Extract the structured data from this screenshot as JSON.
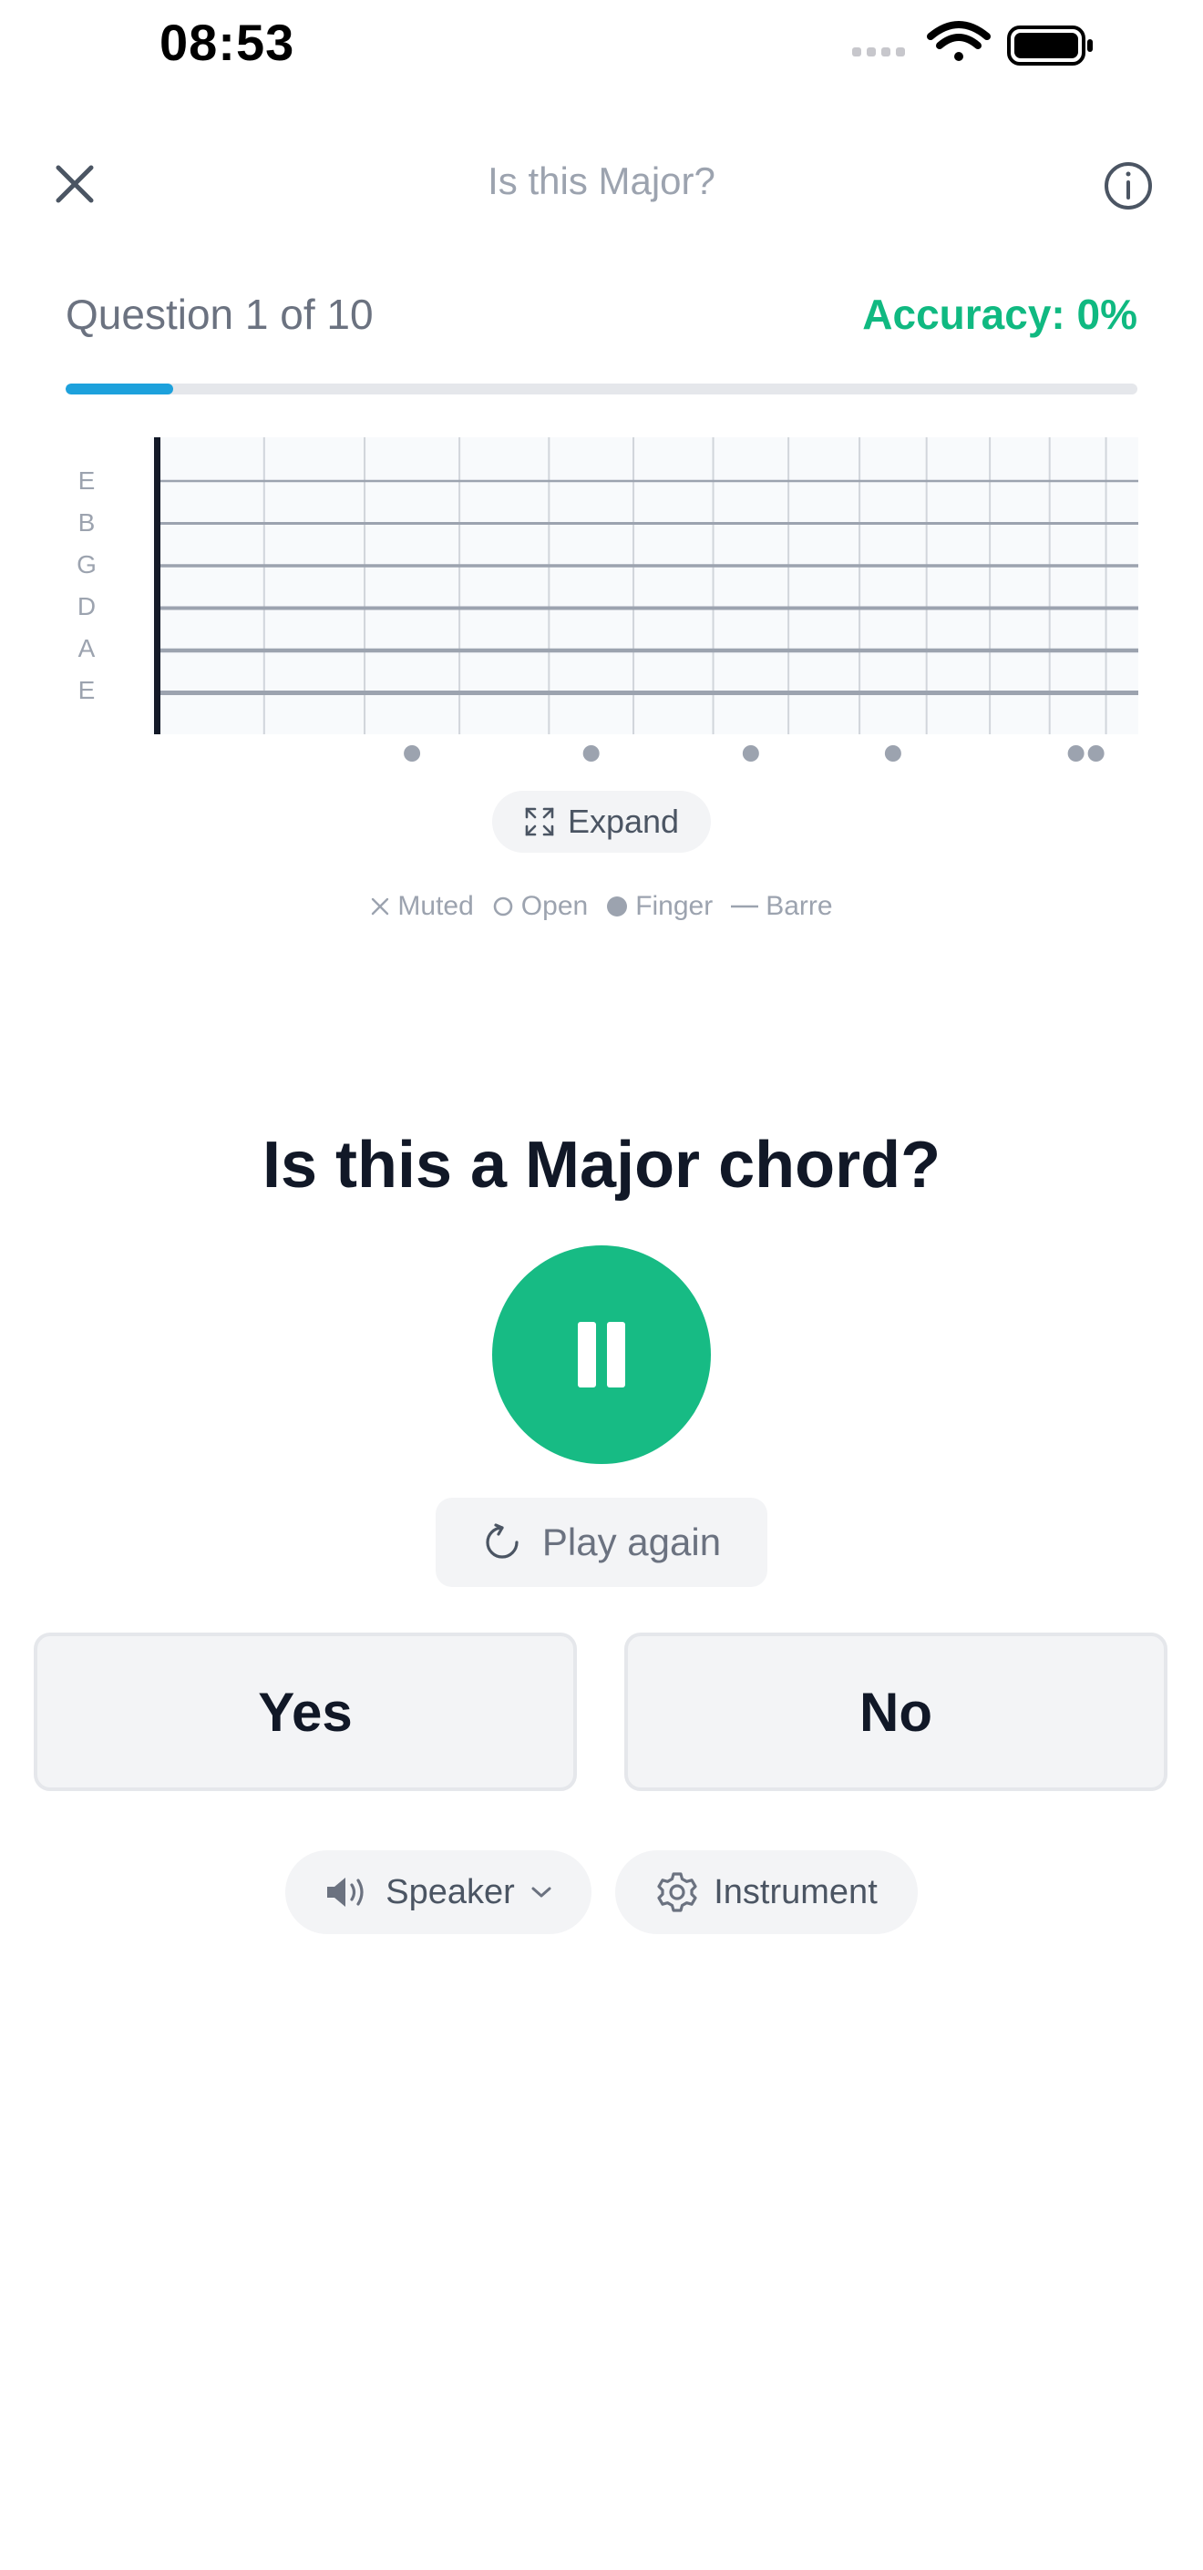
{
  "status_bar": {
    "time": "08:53"
  },
  "header": {
    "title": "Is this Major?"
  },
  "progress": {
    "question_label": "Question 1 of 10",
    "accuracy_label": "Accuracy: 0%",
    "fraction": 0.1,
    "color": "#1da1dc"
  },
  "fretboard": {
    "strings": [
      "E",
      "B",
      "G",
      "D",
      "A",
      "E"
    ],
    "fret_count": 12,
    "inlay_frets_single": [
      3,
      5,
      7,
      9
    ],
    "inlay_frets_double": [
      12
    ]
  },
  "expand": {
    "label": "Expand"
  },
  "legend": {
    "muted": "Muted",
    "open": "Open",
    "finger": "Finger",
    "barre": "Barre"
  },
  "prompt": "Is this a Major chord?",
  "play": {
    "state": "playing",
    "color": "#17bb84",
    "again_label": "Play again"
  },
  "answers": {
    "yes": "Yes",
    "no": "No"
  },
  "controls": {
    "speaker": "Speaker",
    "instrument": "Instrument"
  },
  "colors": {
    "accent": "#10b981",
    "text": "#111827",
    "muted": "#9ca3af"
  }
}
